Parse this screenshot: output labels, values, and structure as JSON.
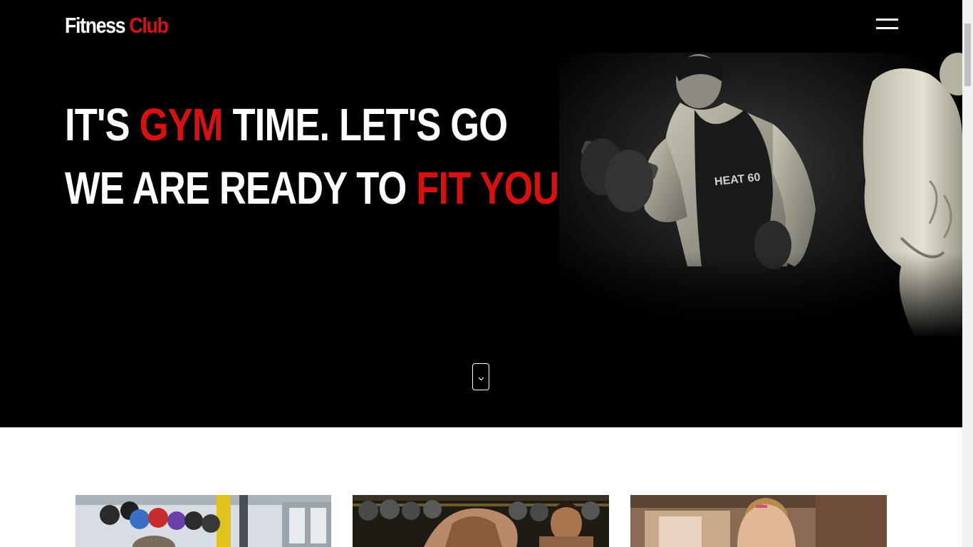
{
  "header": {
    "logo_part1": "Fitness",
    "logo_part2": "Club",
    "menu_icon": "hamburger-menu-icon"
  },
  "hero": {
    "line1": {
      "before": "IT'S ",
      "highlight": "GYM",
      "after": " TIME. LET'S GO"
    },
    "line2": {
      "before": "WE ARE READY TO ",
      "highlight": "FIT YOU"
    },
    "image": "bodybuilders-with-dumbbells",
    "scroll_icon": "chevron-down-icon"
  },
  "cards": [
    {
      "image": "gym-medicine-balls-rack"
    },
    {
      "image": "woman-lifting-dumbbells"
    },
    {
      "image": "woman-training-in-gym"
    }
  ],
  "colors": {
    "accent": "#d81010",
    "hero_background": "#000000",
    "text": "#ffffff"
  }
}
